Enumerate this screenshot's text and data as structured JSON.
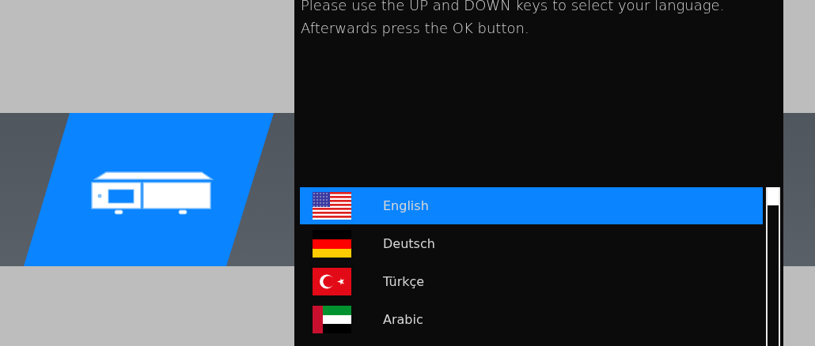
{
  "instructions": [
    "Please use the UP and DOWN keys to select your language.",
    "Afterwards press the OK button."
  ],
  "languages": [
    {
      "label": "English",
      "kind": "us",
      "selected": true
    },
    {
      "label": "Deutsch",
      "kind": "de",
      "selected": false
    },
    {
      "label": "Türkçe",
      "kind": "tr",
      "selected": false
    },
    {
      "label": "Arabic",
      "kind": "ae",
      "selected": false
    }
  ]
}
